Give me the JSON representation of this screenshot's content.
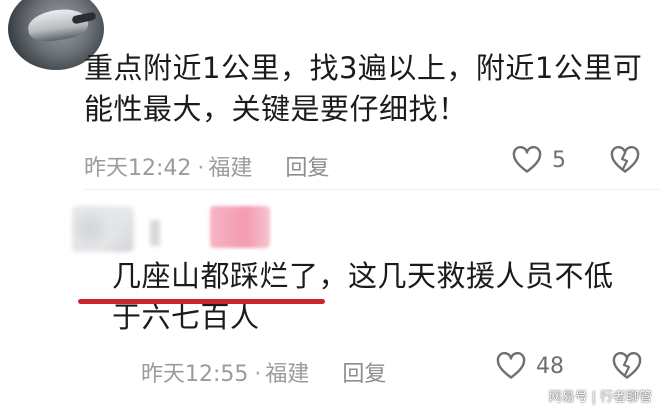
{
  "comments": [
    {
      "text_line1": "重点附近1公里，找3遍以上，附近1公里可",
      "text_line2": "能性最大，关键是要仔细找！",
      "time": "昨天12:42",
      "location": "福建",
      "separator": "·",
      "reply_label": "回复",
      "like_count": "5",
      "avatar_icon": "bird-avatar-icon"
    },
    {
      "text_underlined": "几座山都踩烂了",
      "text_rest_line1": "，这几天救援人员不低",
      "text_line2": "于六七百人",
      "time": "昨天12:55",
      "location": "福建",
      "separator": "·",
      "reply_label": "回复",
      "like_count": "48",
      "underline_color": "#c9262c"
    }
  ],
  "watermark": {
    "left": "网易号",
    "separator": "|",
    "right": "行者聊管"
  },
  "colors": {
    "text": "#1b1b1b",
    "meta": "#9b9b9b",
    "icon": "#6f6f6f"
  }
}
